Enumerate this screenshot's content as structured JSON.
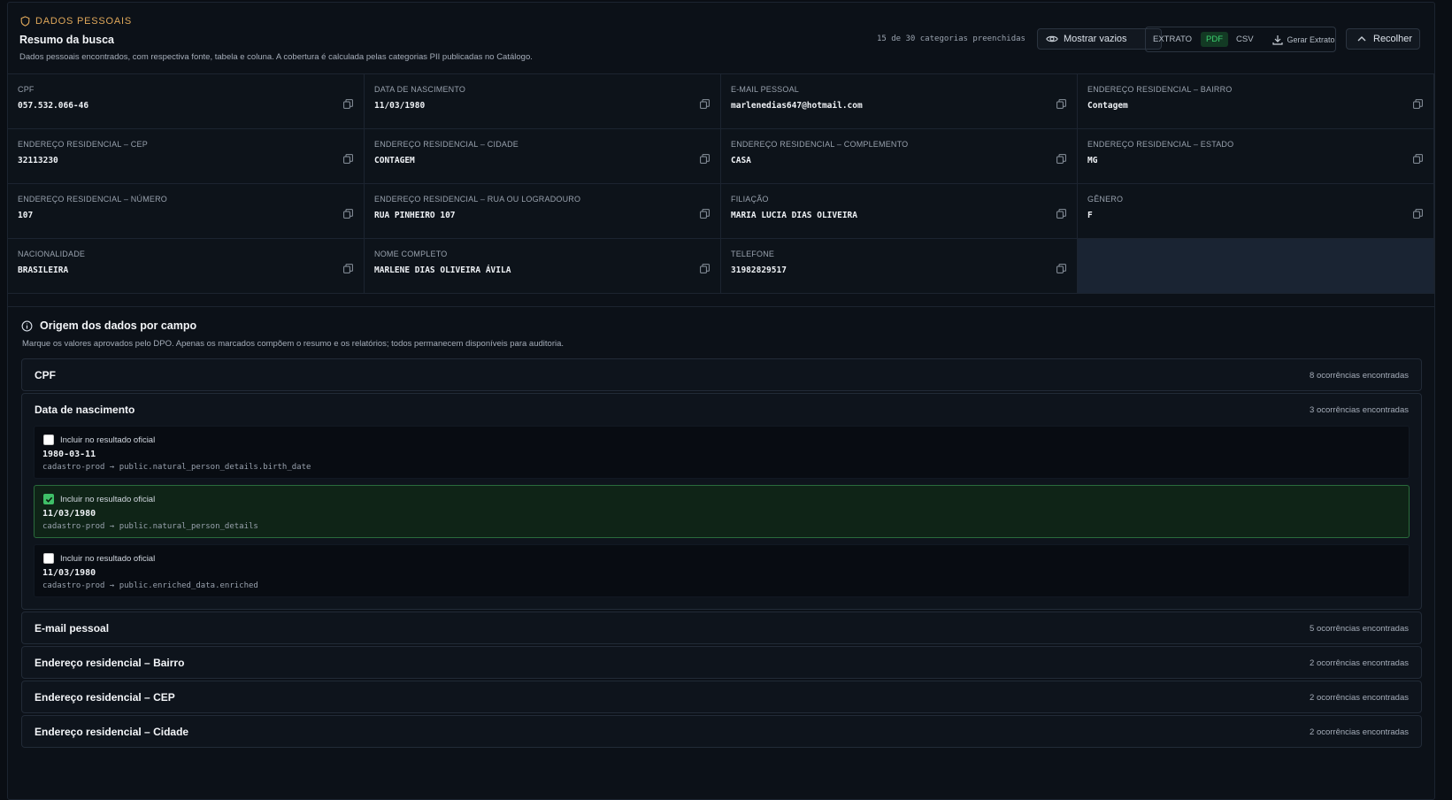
{
  "header": {
    "tag": "DADOS PESSOAIS",
    "title": "Resumo da busca",
    "description": "Dados pessoais encontrados, com respectiva fonte, tabela e coluna. A cobertura é calculada pelas categorias PII publicadas no Catálogo.",
    "count": "15 de 30 categorias preenchidas",
    "show_empty": "Mostrar vazios",
    "extract_label": "EXTRATO",
    "pdf": "PDF",
    "csv": "CSV",
    "generate": "Gerar Extrato",
    "collapse": "Recolher",
    "accent_color": "#e0a85a"
  },
  "fields": [
    {
      "label": "CPF",
      "value": "057.532.066-46"
    },
    {
      "label": "DATA DE NASCIMENTO",
      "value": "11/03/1980"
    },
    {
      "label": "E-MAIL PESSOAL",
      "value": "marlenedias647@hotmail.com"
    },
    {
      "label": "ENDEREÇO RESIDENCIAL – BAIRRO",
      "value": "Contagem"
    },
    {
      "label": "ENDEREÇO RESIDENCIAL – CEP",
      "value": "32113230"
    },
    {
      "label": "ENDEREÇO RESIDENCIAL – CIDADE",
      "value": "CONTAGEM"
    },
    {
      "label": "ENDEREÇO RESIDENCIAL – COMPLEMENTO",
      "value": "CASA"
    },
    {
      "label": "ENDEREÇO RESIDENCIAL – ESTADO",
      "value": "MG"
    },
    {
      "label": "ENDEREÇO RESIDENCIAL – NÚMERO",
      "value": "107"
    },
    {
      "label": "ENDEREÇO RESIDENCIAL – RUA OU LOGRADOURO",
      "value": "RUA PINHEIRO 107"
    },
    {
      "label": "FILIAÇÃO",
      "value": "MARIA LUCIA DIAS OLIVEIRA"
    },
    {
      "label": "GÊNERO",
      "value": "F"
    },
    {
      "label": "NACIONALIDADE",
      "value": "BRASILEIRA"
    },
    {
      "label": "NOME COMPLETO",
      "value": "MARLENE DIAS OLIVEIRA ÁVILA"
    },
    {
      "label": "TELEFONE",
      "value": "31982829517"
    }
  ],
  "origin": {
    "title": "Origem dos dados por campo",
    "description": "Marque os valores aprovados pelo DPO. Apenas os marcados compõem o resumo e os relatórios; todos permanecem disponíveis para auditoria.",
    "include_label": "Incluir no resultado oficial",
    "groups": [
      {
        "title": "CPF",
        "count": "8 ocorrências encontradas"
      },
      {
        "title": "Data de nascimento",
        "count": "3 ocorrências encontradas",
        "items": [
          {
            "value": "1980-03-11",
            "source": "cadastro-prod → public.natural_person_details.birth_date",
            "checked": false
          },
          {
            "value": "11/03/1980",
            "source": "cadastro-prod → public.natural_person_details",
            "checked": true
          },
          {
            "value": "11/03/1980",
            "source": "cadastro-prod → public.enriched_data.enriched",
            "checked": false
          }
        ]
      },
      {
        "title": "E-mail pessoal",
        "count": "5 ocorrências encontradas"
      },
      {
        "title": "Endereço residencial – Bairro",
        "count": "2 ocorrências encontradas"
      },
      {
        "title": "Endereço residencial – CEP",
        "count": "2 ocorrências encontradas"
      },
      {
        "title": "Endereço residencial – Cidade",
        "count": "2 ocorrências encontradas"
      }
    ]
  }
}
